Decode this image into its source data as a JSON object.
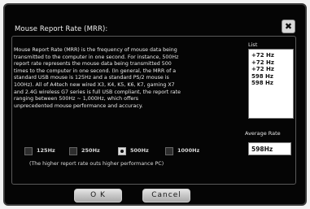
{
  "dialog": {
    "title": "Mouse Report Rate (MRR):",
    "close_label": "✖"
  },
  "description": [
    "Mouse Report Rate (MRR) is the frequency of mouse data being",
    "transmitted to the computer in one second. For instance, 500Hz",
    "report rate represents the mouse data being transmitted 500",
    "times to the computer in one second. (In general, the MRR of a",
    "standard USB mouse is 125Hz and a standard PS/2 mouse is",
    "100Hz). All of A4tech new wired X3, K4, K5, K6, K7, gaming X7",
    "and 2.4G wireless G7 series is full USB compliant, the report rate",
    "ranging between 500Hz ~ 1,000Hz, which offers",
    "unprecedented mouse performance and accuracy."
  ],
  "list": {
    "label": "List",
    "items": [
      "+72 Hz",
      "+72 Hz",
      "+72 Hz",
      "598 Hz",
      "598 Hz"
    ]
  },
  "average": {
    "label": "Average Rate",
    "value": "598Hz"
  },
  "rates": {
    "options": [
      "125Hz",
      "250Hz",
      "500Hz",
      "1000Hz"
    ],
    "selected": "500Hz"
  },
  "hint": "(The higher report rate outs higher performance PC)",
  "buttons": {
    "ok": "O K",
    "cancel": "Cancel"
  }
}
